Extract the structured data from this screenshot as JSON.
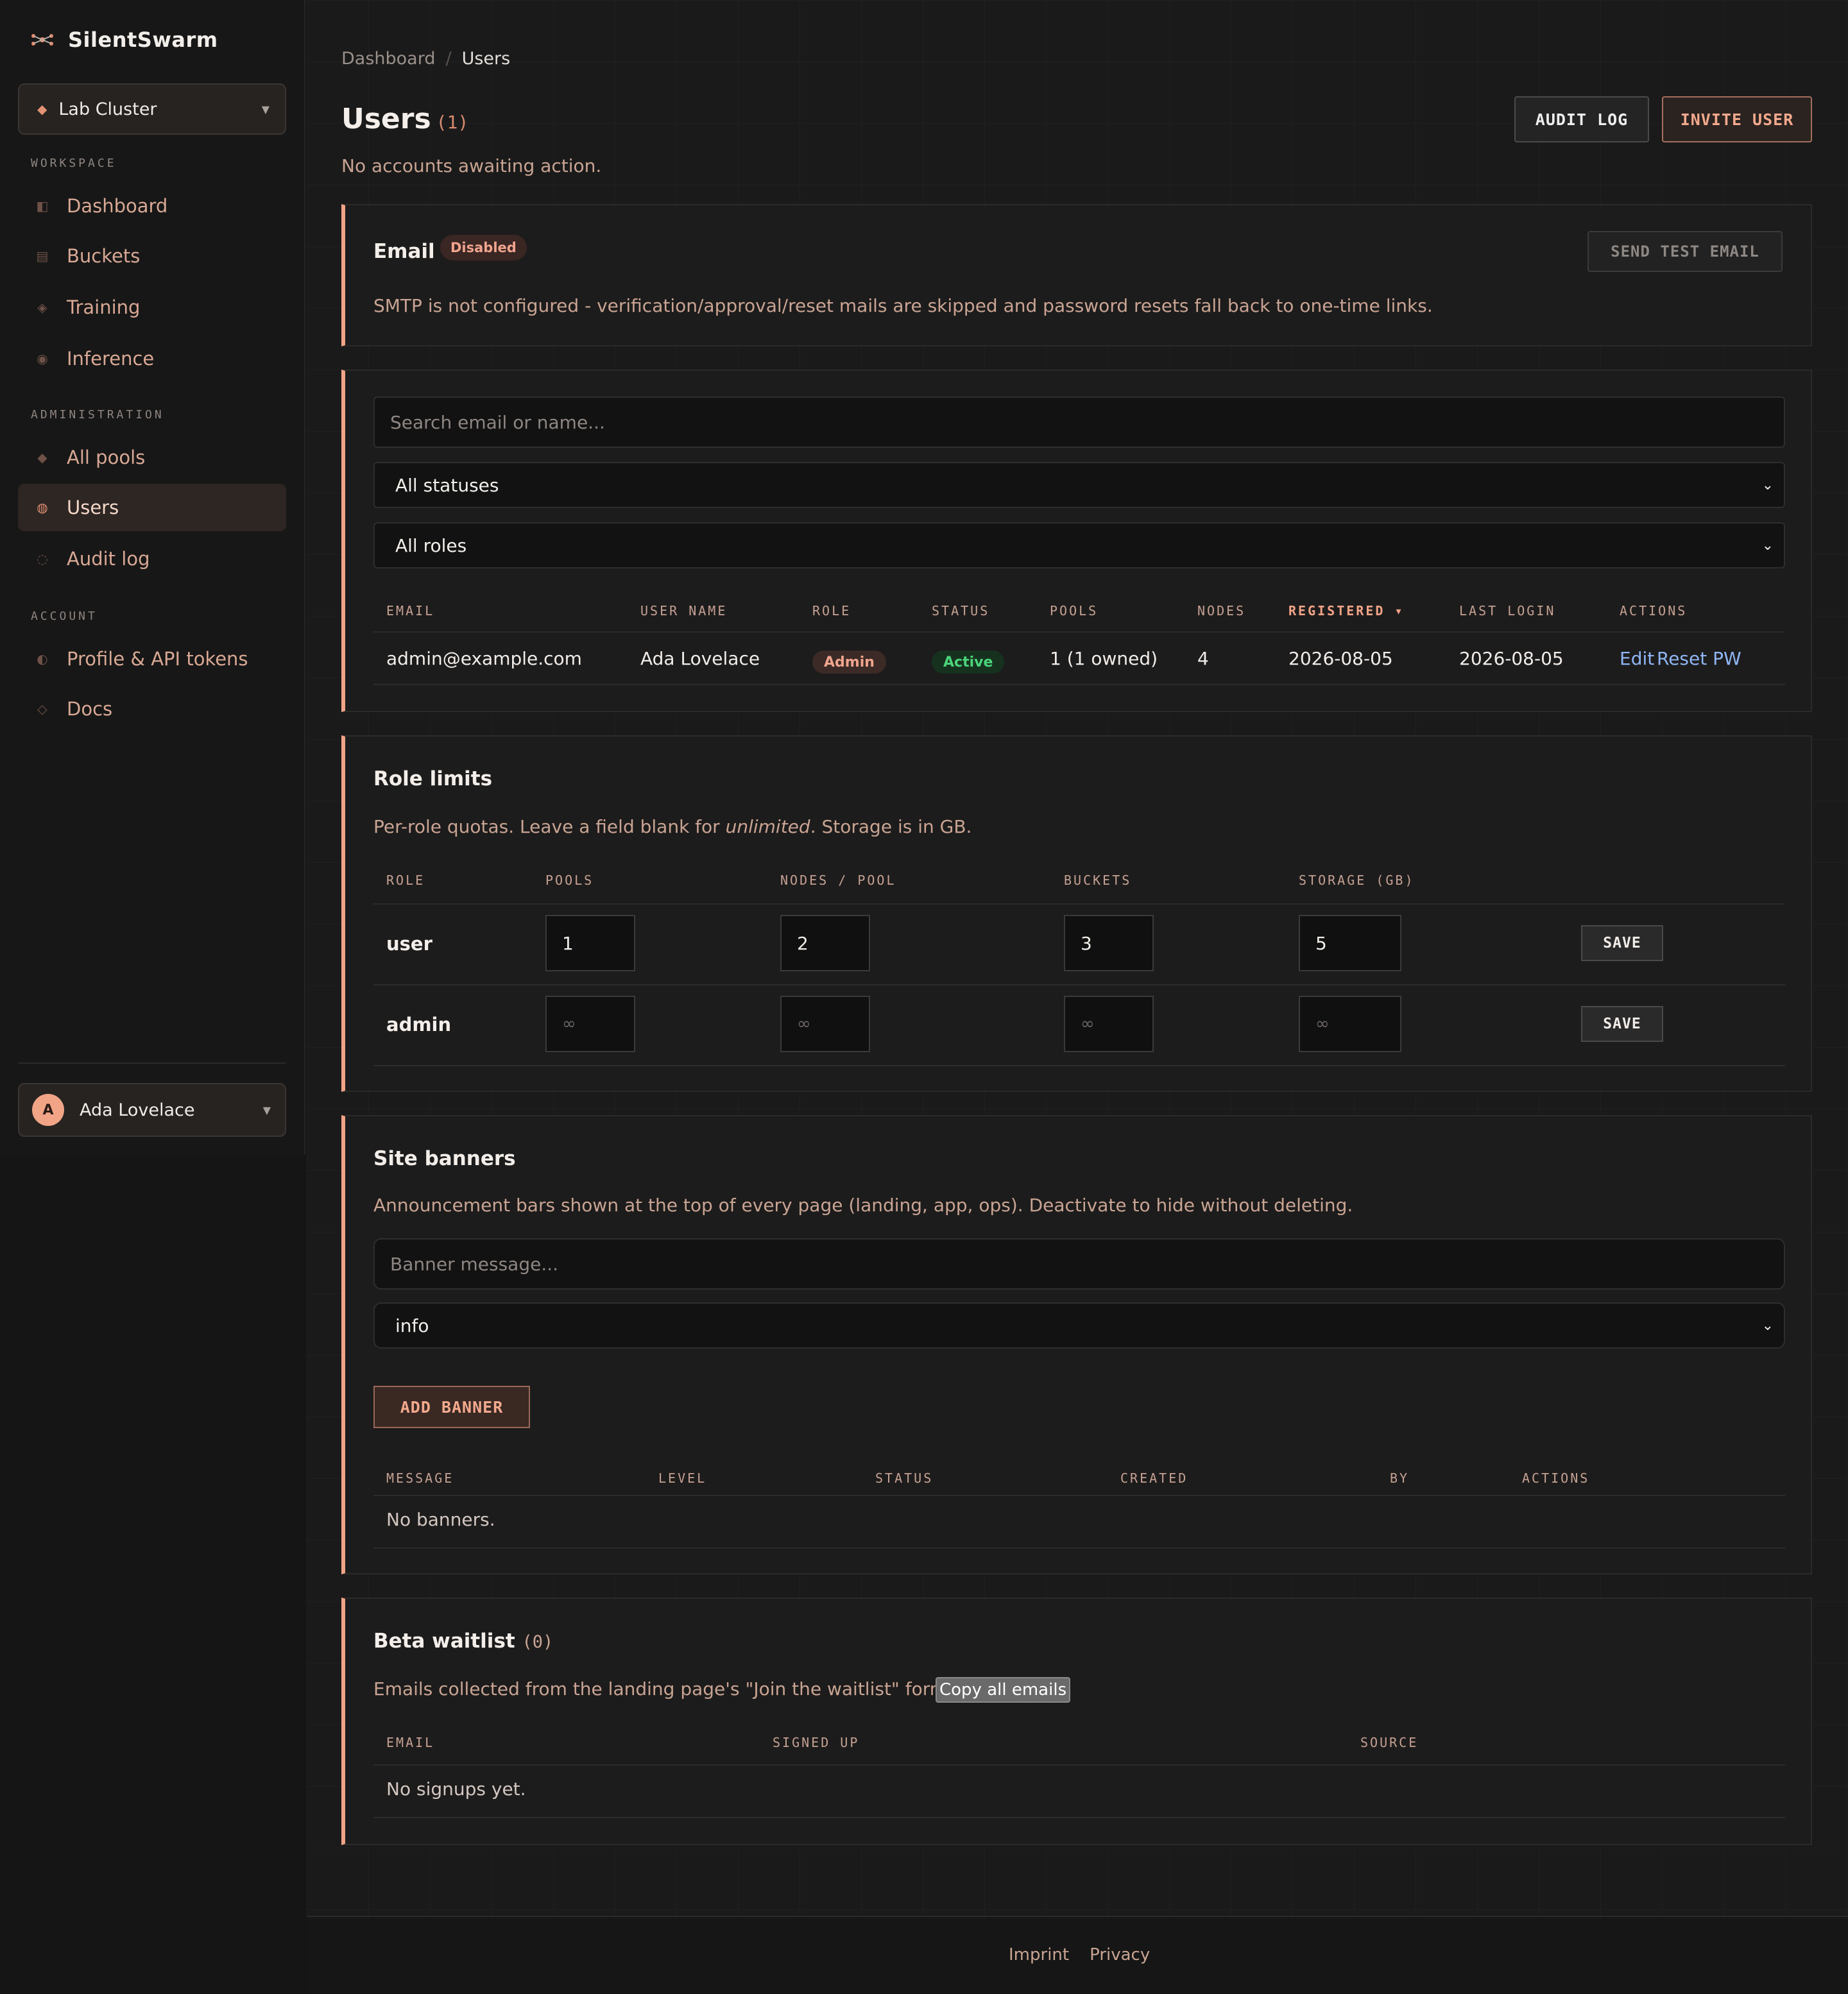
{
  "app": {
    "name": "SilentSwarm",
    "logo_icon": "swarm-icon",
    "accent": "#f2a487"
  },
  "cluster": {
    "name": "Lab Cluster"
  },
  "sidebar": {
    "sections": [
      {
        "title": "WORKSPACE"
      },
      {
        "title": "ADMINISTRATION"
      },
      {
        "title": "ACCOUNT"
      }
    ],
    "items": [
      {
        "label": "Dashboard",
        "icon": "dashboard-icon",
        "glyph": "◧"
      },
      {
        "label": "Buckets",
        "icon": "bucket-icon",
        "glyph": "▤"
      },
      {
        "label": "Training",
        "icon": "training-icon",
        "glyph": "◈"
      },
      {
        "label": "Inference",
        "icon": "inference-icon",
        "glyph": "◉"
      },
      {
        "label": "All pools",
        "icon": "pools-icon",
        "glyph": "◆"
      },
      {
        "label": "Users",
        "icon": "users-icon",
        "glyph": "◍"
      },
      {
        "label": "Audit log",
        "icon": "audit-icon",
        "glyph": "◌"
      },
      {
        "label": "Profile & API tokens",
        "icon": "profile-icon",
        "glyph": "◐"
      },
      {
        "label": "Docs",
        "icon": "docs-icon",
        "glyph": "◇"
      }
    ],
    "user": {
      "initial": "A",
      "name": "Ada Lovelace"
    }
  },
  "breadcrumb": {
    "parent": "Dashboard",
    "separator": "/",
    "current": "Users"
  },
  "header": {
    "title": "Users",
    "count": "(1)",
    "subtitle": "No accounts awaiting action.",
    "audit_button": "AUDIT LOG",
    "invite_button": "INVITE USER"
  },
  "email_card": {
    "title": "Email",
    "badge": "Disabled",
    "test_button": "SEND TEST EMAIL",
    "description": "SMTP is not configured - verification/approval/reset mails are skipped and password resets fall back to one-time links."
  },
  "users_card": {
    "search_placeholder": "Search email or name...",
    "status_filter": "All statuses",
    "role_filter": "All roles",
    "columns": [
      "EMAIL",
      "USER NAME",
      "ROLE",
      "STATUS",
      "POOLS",
      "NODES",
      "REGISTERED ▾",
      "LAST LOGIN",
      "ACTIONS"
    ],
    "rows": [
      {
        "email": "admin@example.com",
        "name": "Ada Lovelace",
        "role": "Admin",
        "status": "Active",
        "pools": "1 (1 owned)",
        "nodes": "4",
        "registered": "2026-08-05",
        "last_login": "2026-08-05",
        "edit": "Edit",
        "reset": "Reset PW"
      }
    ]
  },
  "role_limits": {
    "title": "Role limits",
    "desc_before": "Per-role quotas. Leave a field blank for ",
    "desc_em": "unlimited",
    "desc_after": ". Storage is in GB.",
    "columns": [
      "ROLE",
      "POOLS",
      "NODES / POOL",
      "BUCKETS",
      "STORAGE (GB)"
    ],
    "rows": [
      {
        "role": "user",
        "pools": "1",
        "nodes_per_pool": "2",
        "buckets": "3",
        "storage": "5",
        "save": "SAVE"
      },
      {
        "role": "admin",
        "pools": "∞",
        "nodes_per_pool": "∞",
        "buckets": "∞",
        "storage": "∞",
        "save": "SAVE"
      }
    ]
  },
  "banners": {
    "title": "Site banners",
    "description": "Announcement bars shown at the top of every page (landing, app, ops). Deactivate to hide without deleting.",
    "message_placeholder": "Banner message...",
    "level": "info",
    "add_button": "ADD BANNER",
    "columns": [
      "MESSAGE",
      "LEVEL",
      "STATUS",
      "CREATED",
      "BY",
      "ACTIONS"
    ],
    "empty": "No banners."
  },
  "waitlist": {
    "title": "Beta waitlist",
    "count": "(0)",
    "description": "Emails collected from the landing page's \"Join the waitlist\" form.",
    "copy_button": "Copy all emails",
    "columns": [
      "EMAIL",
      "SIGNED UP",
      "SOURCE"
    ],
    "empty": "No signups yet."
  },
  "footer": {
    "imprint": "Imprint",
    "privacy": "Privacy"
  }
}
